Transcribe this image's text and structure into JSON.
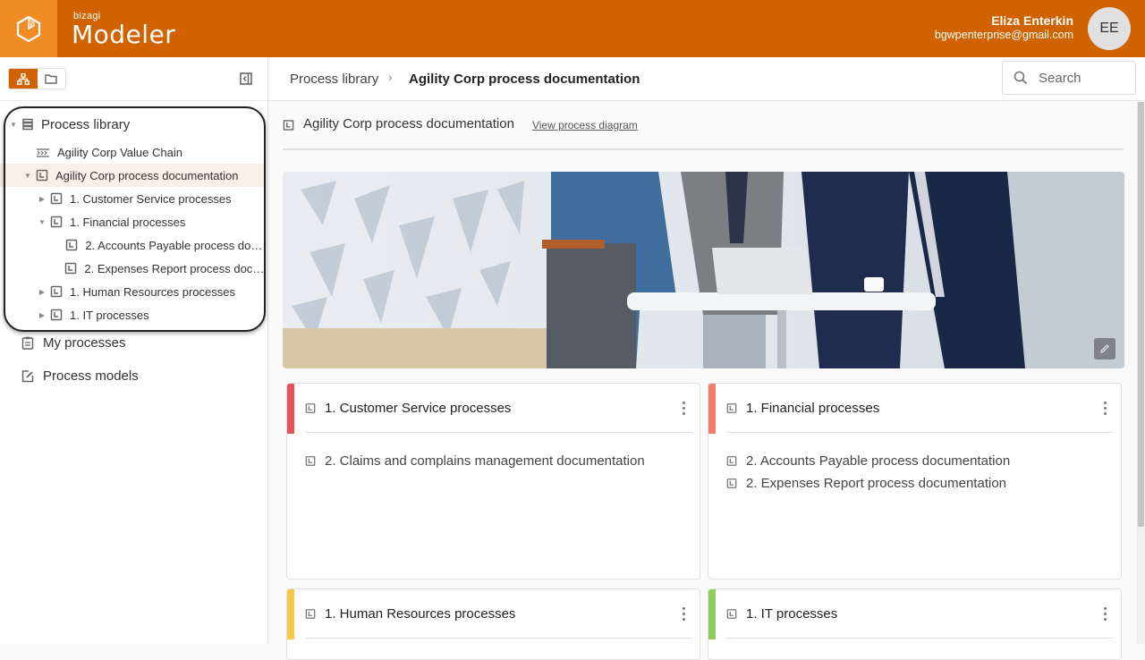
{
  "header": {
    "brand_small": "bizagi",
    "brand_big": "Modeler",
    "user_name": "Eliza Enterkin",
    "user_email": "bgwpenterprise@gmail.com",
    "avatar_initials": "EE",
    "colors": {
      "header_bg": "#d06300",
      "logo_bg": "#f08c26"
    }
  },
  "sidebar": {
    "toggle": {
      "active": "hierarchy-view",
      "items": [
        "hierarchy-view",
        "folder-view"
      ]
    },
    "tree": [
      {
        "label": "Process library",
        "level": 0,
        "expanded": true,
        "icon": "library-icon"
      },
      {
        "label": "Agility Corp Value Chain",
        "level": 1,
        "icon": "value-chain-icon"
      },
      {
        "label": "Agility Corp process documentation",
        "level": 1,
        "expanded": true,
        "selected": true,
        "icon": "document-icon"
      },
      {
        "label": "1. Customer Service processes",
        "level": 2,
        "expanded": false,
        "icon": "document-icon"
      },
      {
        "label": "1. Financial processes",
        "level": 2,
        "expanded": true,
        "icon": "document-icon"
      },
      {
        "label": "2. Accounts Payable process doc...",
        "level": 3,
        "icon": "document-icon"
      },
      {
        "label": "2. Expenses Report process docu...",
        "level": 3,
        "icon": "document-icon"
      },
      {
        "label": "1. Human Resources processes",
        "level": 2,
        "expanded": false,
        "icon": "document-icon"
      },
      {
        "label": "1. IT processes",
        "level": 2,
        "expanded": false,
        "icon": "document-icon"
      }
    ],
    "nav": [
      {
        "label": "My processes",
        "icon": "clipboard-icon"
      },
      {
        "label": "Process models",
        "icon": "edit-document-icon"
      }
    ]
  },
  "topbar": {
    "breadcrumb": [
      "Process library",
      "Agility Corp process documentation"
    ],
    "separator": "›",
    "search_placeholder": "Search"
  },
  "content": {
    "title": "Agility Corp process documentation",
    "view_link": "View process diagram",
    "cards": [
      {
        "title": "1. Customer Service processes",
        "accent": "#e8505b",
        "items": [
          "2. Claims and complains management documentation"
        ]
      },
      {
        "title": "1. Financial processes",
        "accent": "#f47c6a",
        "items": [
          "2. Accounts Payable process documentation",
          "2. Expenses Report process documentation"
        ]
      },
      {
        "title": "1. Human Resources processes",
        "accent": "#f8c948",
        "items": []
      },
      {
        "title": "1. IT processes",
        "accent": "#8fce5a",
        "items": []
      }
    ]
  }
}
